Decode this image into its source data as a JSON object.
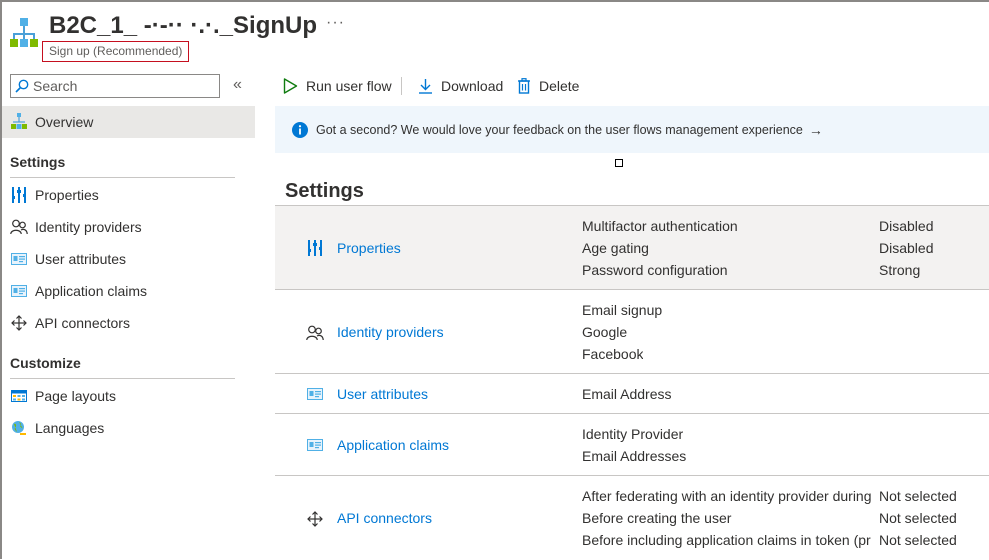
{
  "header": {
    "title": "B2C_1_ -·-·· ·.·._SignUp",
    "more": "···",
    "subtitle": "Sign up (Recommended)"
  },
  "nav": {
    "search_placeholder": "Search",
    "collapse": "«",
    "overview": "Overview",
    "sections": [
      {
        "title": "Settings",
        "items": [
          "Properties",
          "Identity providers",
          "User attributes",
          "Application claims",
          "API connectors"
        ]
      },
      {
        "title": "Customize",
        "items": [
          "Page layouts",
          "Languages"
        ]
      }
    ]
  },
  "toolbar": {
    "run": "Run user flow",
    "download": "Download",
    "delete": "Delete"
  },
  "banner": {
    "text": "Got a second? We would love your feedback on the user flows management experience",
    "arrow": "→"
  },
  "settings": {
    "title": "Settings",
    "rows": [
      {
        "name": "Properties",
        "lines": [
          "Multifactor authentication",
          "Age gating",
          "Password configuration"
        ],
        "values": [
          "Disabled",
          "Disabled",
          "Strong"
        ]
      },
      {
        "name": "Identity providers",
        "lines": [
          "Email signup",
          "Google",
          "Facebook"
        ]
      },
      {
        "name": "User attributes",
        "lines": [
          "Email Address"
        ]
      },
      {
        "name": "Application claims",
        "lines": [
          "Identity Provider",
          "Email Addresses"
        ]
      },
      {
        "name": "API connectors",
        "lines": [
          "After federating with an identity provider during si",
          "Before creating the user",
          "Before including application claims in token (previ"
        ],
        "values": [
          "Not selected",
          "Not selected",
          "Not selected"
        ]
      }
    ]
  },
  "colors": {
    "link": "#0078d4",
    "banner_bg": "#eff6fc",
    "selected_row": "#f3f2f1",
    "run_icon": "#107c10"
  }
}
